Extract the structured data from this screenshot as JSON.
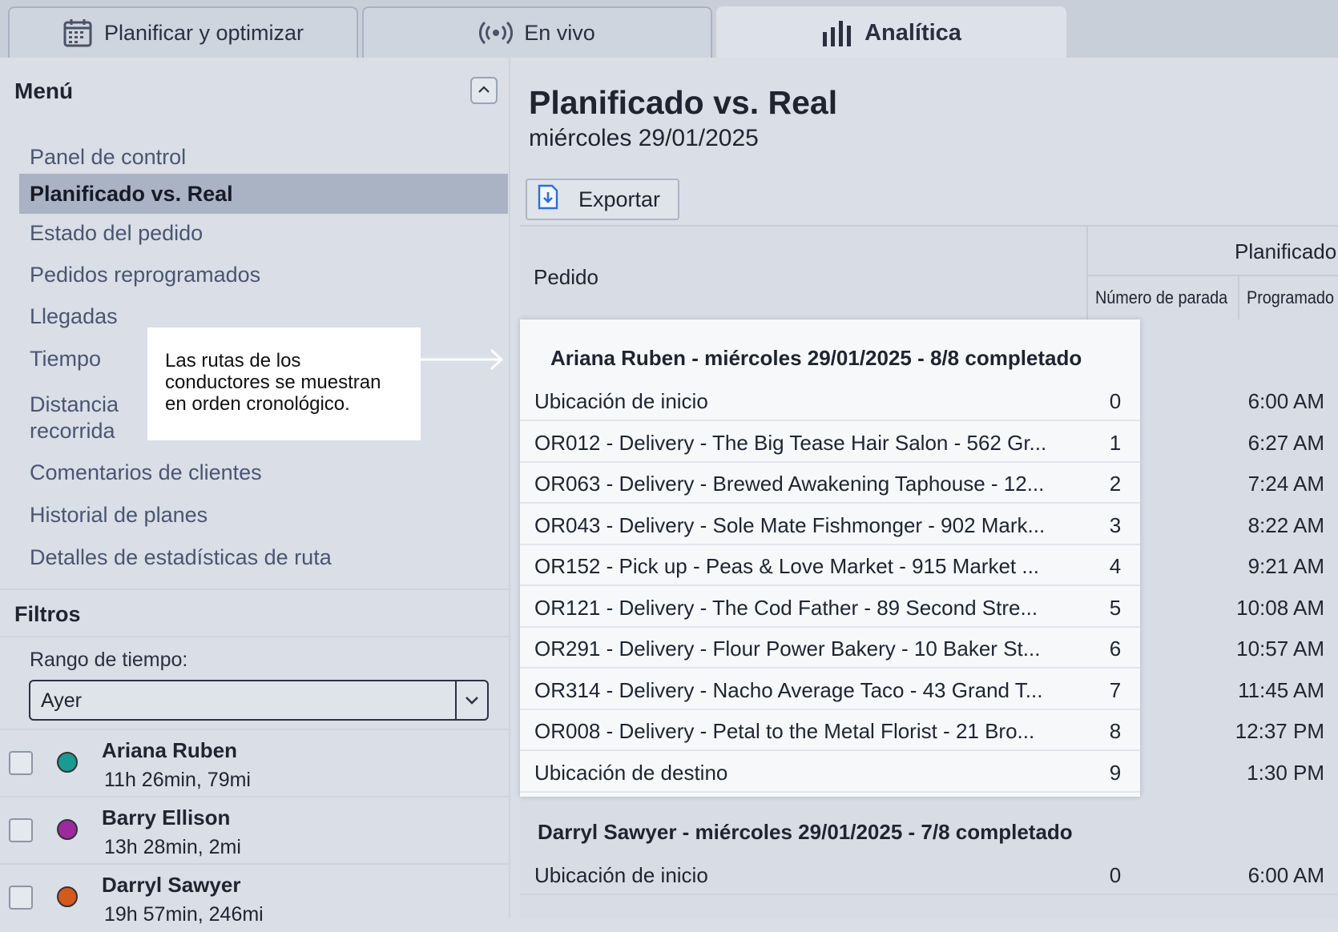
{
  "tabs": [
    {
      "label": "Planificar y optimizar",
      "icon": "calendar-icon",
      "active": false
    },
    {
      "label": "En vivo",
      "icon": "broadcast-icon",
      "active": false
    },
    {
      "label": "Analítica",
      "icon": "bar-chart-icon",
      "active": true
    }
  ],
  "sidebar": {
    "menu_title": "Menú",
    "items": [
      {
        "label": "Panel de control"
      },
      {
        "label": "Planificado vs. Real",
        "active": true
      },
      {
        "label": "Estado del pedido"
      },
      {
        "label": "Pedidos reprogramados"
      },
      {
        "label": "Llegadas"
      },
      {
        "label": "Tiempo"
      },
      {
        "label": "Distancia recorrida"
      },
      {
        "label": "Comentarios de clientes"
      },
      {
        "label": "Historial de planes"
      },
      {
        "label": "Detalles de estadísticas de ruta"
      }
    ],
    "filters_title": "Filtros",
    "time_range_label": "Rango de tiempo:",
    "time_range_value": "Ayer",
    "drivers": [
      {
        "name": "Ariana Ruben",
        "stats": "11h 26min, 79mi",
        "color": "#1a9a92"
      },
      {
        "name": "Barry Ellison",
        "stats": "13h 28min, 2mi",
        "color": "#9a2a9e"
      },
      {
        "name": "Darryl Sawyer",
        "stats": "19h 57min, 246mi",
        "color": "#d25a1c"
      }
    ]
  },
  "main": {
    "title": "Planificado vs. Real",
    "date": "miércoles 29/01/2025",
    "export_label": "Exportar",
    "columns": {
      "order": "Pedido",
      "planned": "Planificado",
      "stop_number": "Número de parada",
      "scheduled": "Programado"
    },
    "groups": [
      {
        "title": "Ariana Ruben - miércoles 29/01/2025 - 8/8  completado",
        "rows": [
          {
            "name": "Ubicación de inicio",
            "stop": "0",
            "time": "6:00 AM"
          },
          {
            "name": "OR012 - Delivery - The Big Tease Hair Salon - 562 Gr...",
            "stop": "1",
            "time": "6:27 AM"
          },
          {
            "name": "OR063 - Delivery - Brewed Awakening Taphouse - 12...",
            "stop": "2",
            "time": "7:24 AM"
          },
          {
            "name": "OR043 - Delivery - Sole Mate Fishmonger - 902 Mark...",
            "stop": "3",
            "time": "8:22 AM"
          },
          {
            "name": "OR152 - Pick up - Peas & Love Market - 915 Market ...",
            "stop": "4",
            "time": "9:21 AM"
          },
          {
            "name": "OR121 - Delivery - The Cod Father - 89 Second Stre...",
            "stop": "5",
            "time": "10:08 AM"
          },
          {
            "name": "OR291 - Delivery - Flour Power Bakery - 10 Baker St...",
            "stop": "6",
            "time": "10:57 AM"
          },
          {
            "name": "OR314 - Delivery - Nacho Average Taco - 43 Grand T...",
            "stop": "7",
            "time": "11:45 AM"
          },
          {
            "name": "OR008 - Delivery - Petal to the Metal Florist - 21 Bro...",
            "stop": "8",
            "time": "12:37 PM"
          },
          {
            "name": "Ubicación de destino",
            "stop": "9",
            "time": "1:30 PM"
          }
        ]
      },
      {
        "title": "Darryl Sawyer - miércoles 29/01/2025 - 7/8 completado",
        "rows": [
          {
            "name": "Ubicación de inicio",
            "stop": "0",
            "time": "6:00 AM"
          }
        ]
      }
    ]
  },
  "callout": {
    "text": "Las rutas de los conductores se muestran en orden cronológico."
  }
}
